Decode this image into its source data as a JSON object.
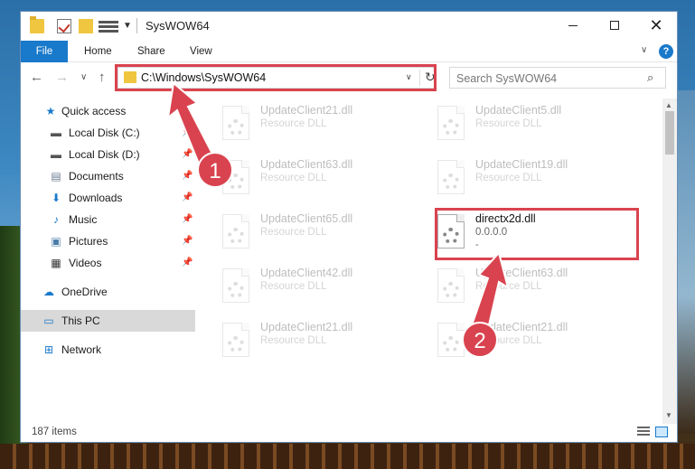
{
  "window": {
    "title": "SysWOW64",
    "minimize_label": "Minimize",
    "maximize_label": "Maximize",
    "close_label": "Close"
  },
  "ribbon": {
    "tabs": [
      "File",
      "Home",
      "Share",
      "View"
    ],
    "help": "?"
  },
  "address": {
    "path": "C:\\Windows\\SysWOW64",
    "search_placeholder": "Search SysWOW64"
  },
  "sidebar": {
    "items": [
      {
        "label": "Quick access",
        "icon": "star-icon"
      },
      {
        "label": "Local Disk (C:)",
        "icon": "drive-icon",
        "pinned": true
      },
      {
        "label": "Local Disk (D:)",
        "icon": "drive-icon",
        "pinned": true
      },
      {
        "label": "Documents",
        "icon": "documents-icon",
        "pinned": true
      },
      {
        "label": "Downloads",
        "icon": "download-icon",
        "pinned": true
      },
      {
        "label": "Music",
        "icon": "music-icon",
        "pinned": true
      },
      {
        "label": "Pictures",
        "icon": "pictures-icon",
        "pinned": true
      },
      {
        "label": "Videos",
        "icon": "videos-icon",
        "pinned": true
      },
      {
        "label": "OneDrive",
        "icon": "cloud-icon"
      },
      {
        "label": "This PC",
        "icon": "computer-icon",
        "selected": true
      },
      {
        "label": "Network",
        "icon": "network-icon"
      }
    ]
  },
  "files": [
    {
      "name": "UpdateClient21.dll",
      "type": "Resource DLL"
    },
    {
      "name": "UpdateClient5.dll",
      "type": "Resource DLL"
    },
    {
      "name": "UpdateClient63.dll",
      "type": "Resource DLL"
    },
    {
      "name": "UpdateClient19.dll",
      "type": "Resource DLL"
    },
    {
      "name": "UpdateClient65.dll",
      "type": "Resource DLL"
    },
    {
      "name": "directx2d.dll",
      "type": "0.0.0.0",
      "size": "-",
      "highlighted": true
    },
    {
      "name": "UpdateClient42.dll",
      "type": "Resource DLL"
    },
    {
      "name": "UpdateClient63.dll",
      "type": "Resource DLL"
    },
    {
      "name": "UpdateClient21.dll",
      "type": "Resource DLL"
    },
    {
      "name": "UpdateClient21.dll",
      "type": "Resource DLL"
    }
  ],
  "status": {
    "item_count": "187 items"
  },
  "annotations": {
    "step1": "1",
    "step2": "2",
    "color": "#d9434f"
  }
}
